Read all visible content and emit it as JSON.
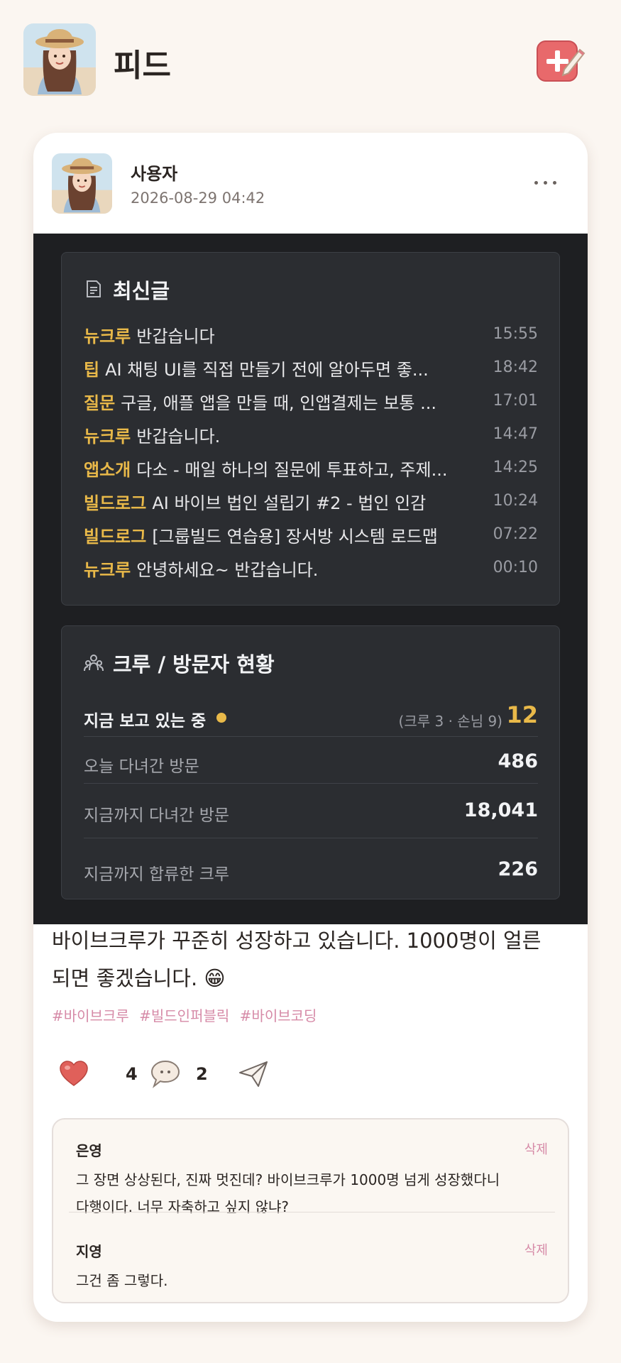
{
  "header": {
    "title": "피드",
    "avatar_icon": "user-avatar-icon",
    "compose_icon": "compose-icon"
  },
  "post": {
    "author": "사용자",
    "timestamp": "2026-08-29 04:42",
    "more_icon": "more-horizontal-icon",
    "embed": {
      "recent": {
        "title": "최신글",
        "icon": "document-icon",
        "items": [
          {
            "category": "뉴크루",
            "title": "반갑습니다",
            "time": "15:55"
          },
          {
            "category": "팁",
            "title": "AI 채팅 UI를 직접 만들기 전에 알아두면 좋...",
            "time": "18:42"
          },
          {
            "category": "질문",
            "title": "구글, 애플 앱을 만들 때, 인앱결제는 보통 ...",
            "time": "17:01"
          },
          {
            "category": "뉴크루",
            "title": "반갑습니다.",
            "time": "14:47"
          },
          {
            "category": "앱소개",
            "title": "다소 - 매일 하나의 질문에 투표하고, 주제...",
            "time": "14:25"
          },
          {
            "category": "빌드로그",
            "title": "AI 바이브 법인 설립기 #2 - 법인 인감",
            "time": "10:24"
          },
          {
            "category": "빌드로그",
            "title": "[그룹빌드 연습용] 장서방 시스템 로드맵",
            "time": "07:22"
          },
          {
            "category": "뉴크루",
            "title": "안녕하세요~ 반갑습니다.",
            "time": "00:10"
          }
        ]
      },
      "stats": {
        "title": "크루 / 방문자 현황",
        "icon": "people-icon",
        "live_label": "지금 보고 있는 중",
        "live_breakdown": "(크루 3 · 손님 9)",
        "live_count": "12",
        "today_label": "오늘 다녀간 방문",
        "today_value": "486",
        "total_label": "지금까지 다녀간 방문",
        "total_value": "18,041",
        "crew_label": "지금까지 합류한 크루",
        "crew_value": "226"
      }
    },
    "body_line1": "바이브크루가 꾸준히 성장하고 있습니다. 1000명이 얼른",
    "body_line2": "되면 좋겠습니다. 😁",
    "hashtags": [
      "#바이브크루",
      "#빌드인퍼블릭",
      "#바이브코딩"
    ],
    "likes": "4",
    "comments_count": "2",
    "comments": [
      {
        "author": "은영",
        "delete_label": "삭제",
        "line1": "그 장면 상상된다, 진짜 멋진데? 바이브크루가 1000명 넘게 성장했다니",
        "line2": "다행이다. 너무 자축하고 싶지 않냐?"
      },
      {
        "author": "지영",
        "delete_label": "삭제",
        "line1": "그건 좀 그렇다."
      }
    ]
  },
  "colors": {
    "background": "#fbf6f1",
    "accent_gold": "#e9b949",
    "hashtag_pink": "#d68aa7",
    "embed_dark": "#1e1f22",
    "heart_red": "#e0605a"
  }
}
